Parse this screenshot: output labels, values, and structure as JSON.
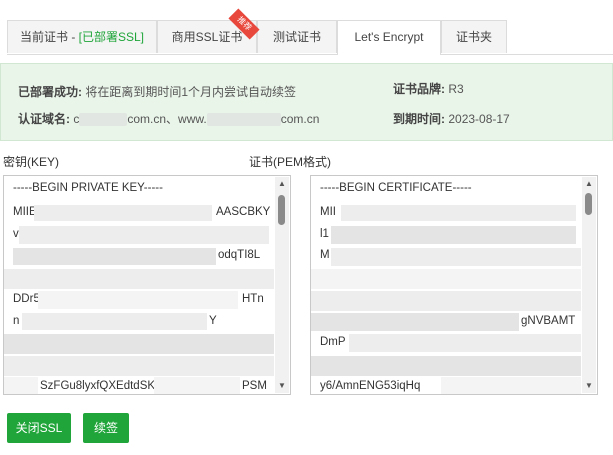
{
  "tabs": [
    {
      "label": "当前证书 - ",
      "suffix": "[已部署SSL]"
    },
    {
      "label": "商用SSL证书",
      "badge": "推荐"
    },
    {
      "label": "测试证书"
    },
    {
      "label": "Let's Encrypt"
    },
    {
      "label": "证书夹"
    }
  ],
  "info": {
    "deploy_label": "已部署成功:",
    "deploy_text": "将在距离到期时间1个月内尝试自动续签",
    "brand_label": "证书品牌:",
    "brand_value": "R3",
    "domain_label": "认证域名:",
    "domain_prefix_1": "c",
    "domain_suffix_1": "com.cn、www.",
    "domain_suffix_2": "com.cn",
    "expire_label": "到期时间:",
    "expire_value": "2023-08-17"
  },
  "key": {
    "label": "密钥(KEY)",
    "lines": [
      "-----BEGIN PRIVATE KEY-----",
      "MIIE",
      "AASCBKY",
      "v",
      "odqTI8L",
      "DDr5M",
      "HTn",
      "n",
      "Y",
      "PSM",
      "SzFGu8lyxfQXEdtdSK"
    ]
  },
  "cert": {
    "label": "证书(PEM格式)",
    "lines": [
      "-----BEGIN CERTIFICATE-----",
      "MII",
      "l1",
      "M",
      "gNVBAMT",
      "DmP",
      "y6/AmnENG53iqHq"
    ]
  },
  "buttons": {
    "close_ssl": "关闭SSL",
    "renew": "续签"
  },
  "colors": {
    "accent": "#20a53a",
    "info_bg": "#eaf5ea",
    "badge": "#e8473c"
  }
}
